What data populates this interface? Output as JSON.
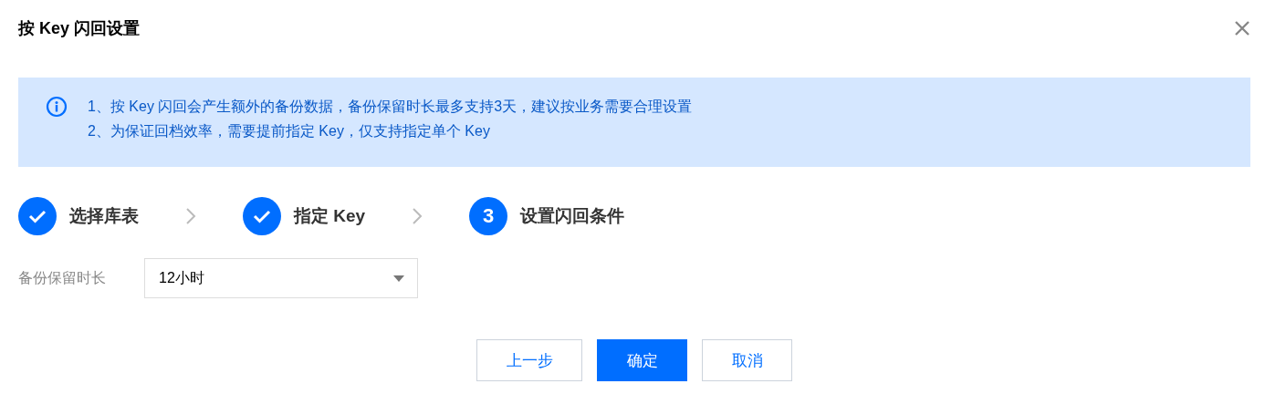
{
  "dialog": {
    "title": "按 Key 闪回设置"
  },
  "notice": {
    "lines": [
      "1、按 Key 闪回会产生额外的备份数据，备份保留时长最多支持3天，建议按业务需要合理设置",
      "2、为保证回档效率，需要提前指定 Key，仅支持指定单个 Key"
    ]
  },
  "steps": [
    {
      "label": "选择库表",
      "kind": "done"
    },
    {
      "label": "指定 Key",
      "kind": "done"
    },
    {
      "label": "设置闪回条件",
      "kind": "current",
      "number": "3"
    }
  ],
  "form": {
    "label": "备份保留时长",
    "select": {
      "value": "12小时"
    }
  },
  "buttons": [
    {
      "label": "上一步",
      "kind": "default"
    },
    {
      "label": "确定",
      "kind": "primary"
    },
    {
      "label": "取消",
      "kind": "default"
    }
  ]
}
